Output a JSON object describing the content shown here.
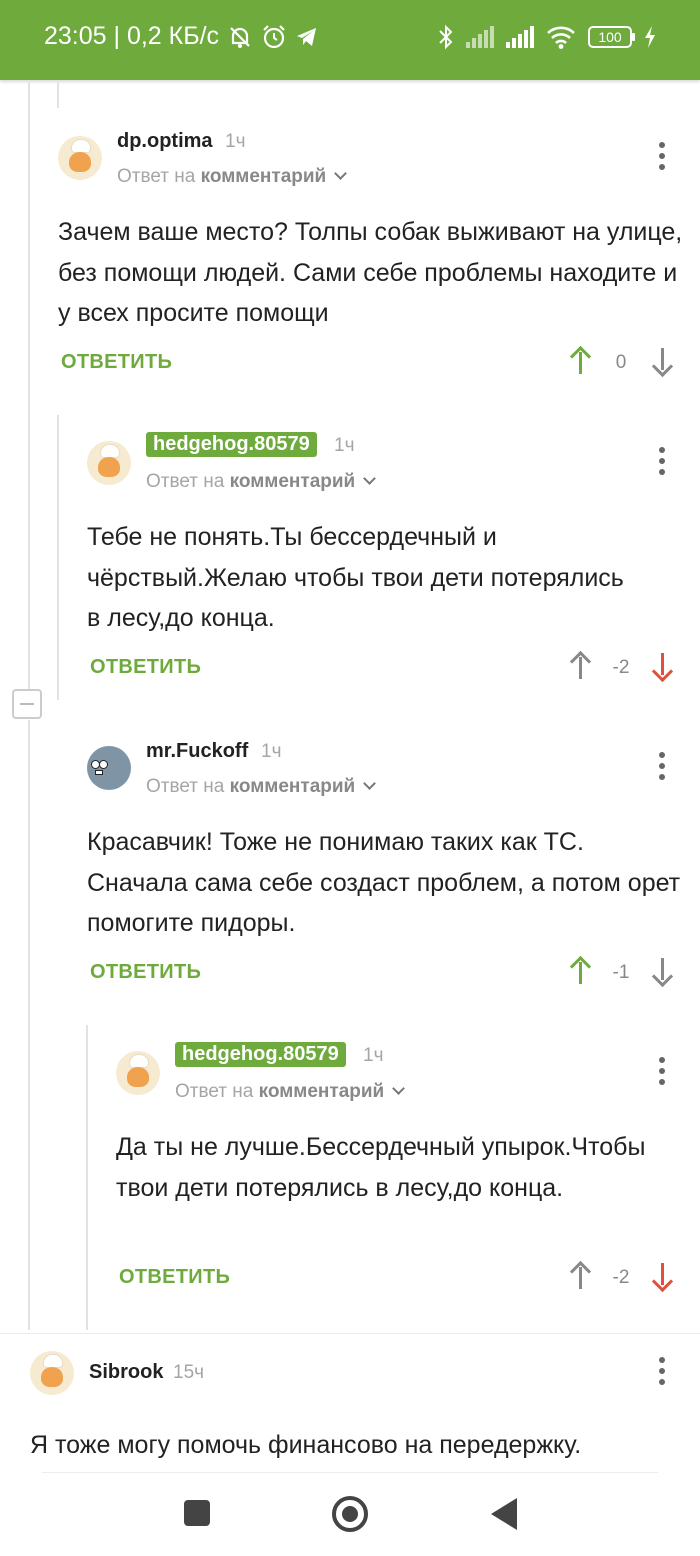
{
  "status_bar": {
    "time_speed": "23:05 | 0,2 КБ/с",
    "battery": "100"
  },
  "reply_to": {
    "prefix": "Ответ на",
    "link": "комментарий"
  },
  "actions": {
    "reply_label": "ОТВЕТИТЬ"
  },
  "comments": [
    {
      "username": "dp.optima",
      "time": "1ч",
      "text": "Зачем ваше место? Толпы собак выживают на улице, без помощи людей. Сами себе проблемы находите и у всех просите помощи",
      "score": "0",
      "vote_state": "upvoted"
    },
    {
      "username": "hedgehog.80579",
      "time": "1ч",
      "text": "Тебе не понять.Ты бессердечный и чёрствый.Желаю чтобы твои дети потерялись в лесу,до конца.",
      "score": "-2",
      "vote_state": "downvoted"
    },
    {
      "username": "mr.Fuckoff",
      "time": "1ч",
      "text": "Красавчик! Тоже не понимаю таких как ТС. Сначала сама себе создаст проблем, а потом орет помогите пидоры.",
      "score": "-1",
      "vote_state": "upvoted"
    },
    {
      "username": "hedgehog.80579",
      "time": "1ч",
      "text": "Да ты не лучше.Бессердечный упырок.Чтобы твои дети потерялись в лесу,до конца.",
      "score": "-2",
      "vote_state": "downvoted"
    },
    {
      "username": "Sibrook",
      "time": "15ч",
      "text": "Я тоже могу помочь финансово на передержку."
    }
  ],
  "colors": {
    "accent": "#6faa3c",
    "downvote": "#e0503c",
    "muted": "#a5a5a5"
  }
}
